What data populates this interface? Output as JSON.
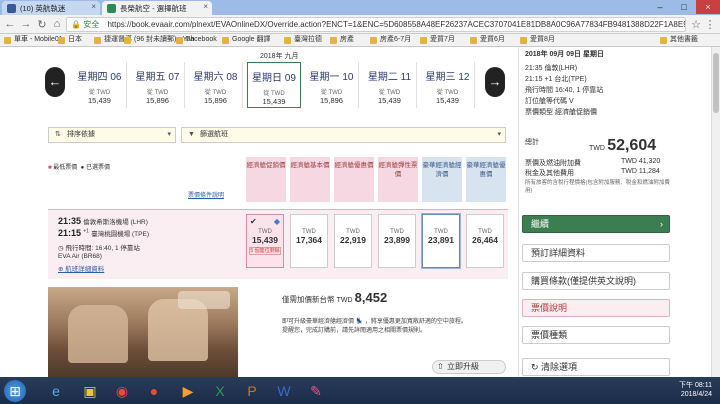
{
  "browser": {
    "tabs": [
      {
        "label": "(10) 英航執迷",
        "active": false,
        "fav_color": "#3b5998"
      },
      {
        "label": "長榮航空 - 選擇航班",
        "active": true,
        "fav_color": "#2e8b57"
      }
    ],
    "url": "https://book.evaair.com/plnext/EVAOnlineDX/Override.action?ENCT=1&ENC=5D608558A48EF26237ACEC3707041E81DB8A0C96A77834FB9481388D22F1A8E9A71...",
    "secure_label": "安全",
    "bookmarks": [
      "單車 - Mobile01",
      "日本",
      "捷運督導",
      "(96 封未讀郵) - Yah",
      "Facebook",
      "Google 翻譯",
      "臺灣拉德",
      "房產",
      "房產6-7月",
      "愛買7月",
      "愛買6月",
      "愛買8月",
      "其他書籤"
    ]
  },
  "calendar": {
    "month": "2018年 九月",
    "days": [
      {
        "label": "星期四 06",
        "currency": "從 TWD",
        "price": "15,439"
      },
      {
        "label": "星期五 07",
        "currency": "從 TWD",
        "price": "15,896"
      },
      {
        "label": "星期六 08",
        "currency": "從 TWD",
        "price": "15,896"
      },
      {
        "label": "星期日 09",
        "currency": "從 TWD",
        "price": "15,439"
      },
      {
        "label": "星期一 10",
        "currency": "從 TWD",
        "price": "15,896"
      },
      {
        "label": "星期二 11",
        "currency": "從 TWD",
        "price": "15,439"
      },
      {
        "label": "星期三 12",
        "currency": "從 TWD",
        "price": "15,439"
      }
    ],
    "selected_index": 3
  },
  "filters": {
    "sort": "排序依據",
    "filter": "篩選航班"
  },
  "legend": {
    "cheapest": "最低票價",
    "selected": "已選票價",
    "compare": "票價條件說明"
  },
  "fare_headers": [
    {
      "label": "經濟艙促銷價",
      "color": "#f6d8e3"
    },
    {
      "label": "經濟艙基本價",
      "color": "#f6d8e3"
    },
    {
      "label": "經濟艙優惠價",
      "color": "#f6d8e3"
    },
    {
      "label": "經濟艙彈性票價",
      "color": "#f6d8e3"
    },
    {
      "label": "豪華經濟艙經濟價",
      "color": "#d8e3f0"
    },
    {
      "label": "豪華經濟艙優惠價",
      "color": "#d8e3f0"
    }
  ],
  "flight": {
    "depart": "21:35",
    "depart_place": "倫敦希斯洛機場 (LHR)",
    "arrive": "21:15",
    "arrive_sup": "+1",
    "arrive_place": "臺灣桃園機場 (TPE)",
    "duration": "飛行時間: 16:40, 1 停靠站",
    "airline": "EVA Air (BR68)",
    "details": "航班詳細資料",
    "fares": [
      {
        "currency": "TWD",
        "price": "15,439",
        "note": "5 個座位剩餘",
        "selected": true
      },
      {
        "currency": "TWD",
        "price": "17,364"
      },
      {
        "currency": "TWD",
        "price": "22,919"
      },
      {
        "currency": "TWD",
        "price": "23,899"
      },
      {
        "currency": "TWD",
        "price": "23,891",
        "highlight": true
      },
      {
        "currency": "TWD",
        "price": "26,464"
      }
    ]
  },
  "upgrade": {
    "label": "僅需加價新台幣",
    "currency": "TWD",
    "amount": "8,452",
    "desc1": "即可升級豪華經濟艙經濟價",
    "desc2": "，將享優惠更加寬敞舒適的空中旅程。",
    "desc3": "提醒您，完成訂購前，請先詳閱適用之相關票價規則。",
    "button": "立即升級"
  },
  "summary": {
    "date": "2018年 09月 09日 星期日",
    "depart": "21:35 倫敦(LHR)",
    "arrive": "21:15 +1 台北(TPE)",
    "duration": "飛行時間 16:40, 1 停靠站",
    "cabin": "訂位艙等代碼 V",
    "fare_type": "票價類型 經濟艙促銷價",
    "total_label": "總計",
    "total_currency": "TWD",
    "total": "52,604",
    "fare_line": "票價及燃油附加費",
    "fare_line_val": "TWD 41,320",
    "tax_line": "稅金及其他費用",
    "tax_line_val": "TWD 11,284",
    "note": "所有旅客的含稅行程價格(包含附加服務、稅金和燃油附加費用)",
    "buttons": [
      {
        "label": "繼續",
        "style": "green"
      },
      {
        "label": "預訂詳細資料",
        "style": "plain"
      },
      {
        "label": "購買條款(僅提供英文說明)",
        "style": "plain"
      },
      {
        "label": "票價說明",
        "style": "red"
      },
      {
        "label": "票價種類",
        "style": "plain"
      },
      {
        "label": "清除選項",
        "style": "plain"
      }
    ]
  },
  "taskbar": {
    "time": "下午 08:11",
    "date": "2018/4/24"
  }
}
